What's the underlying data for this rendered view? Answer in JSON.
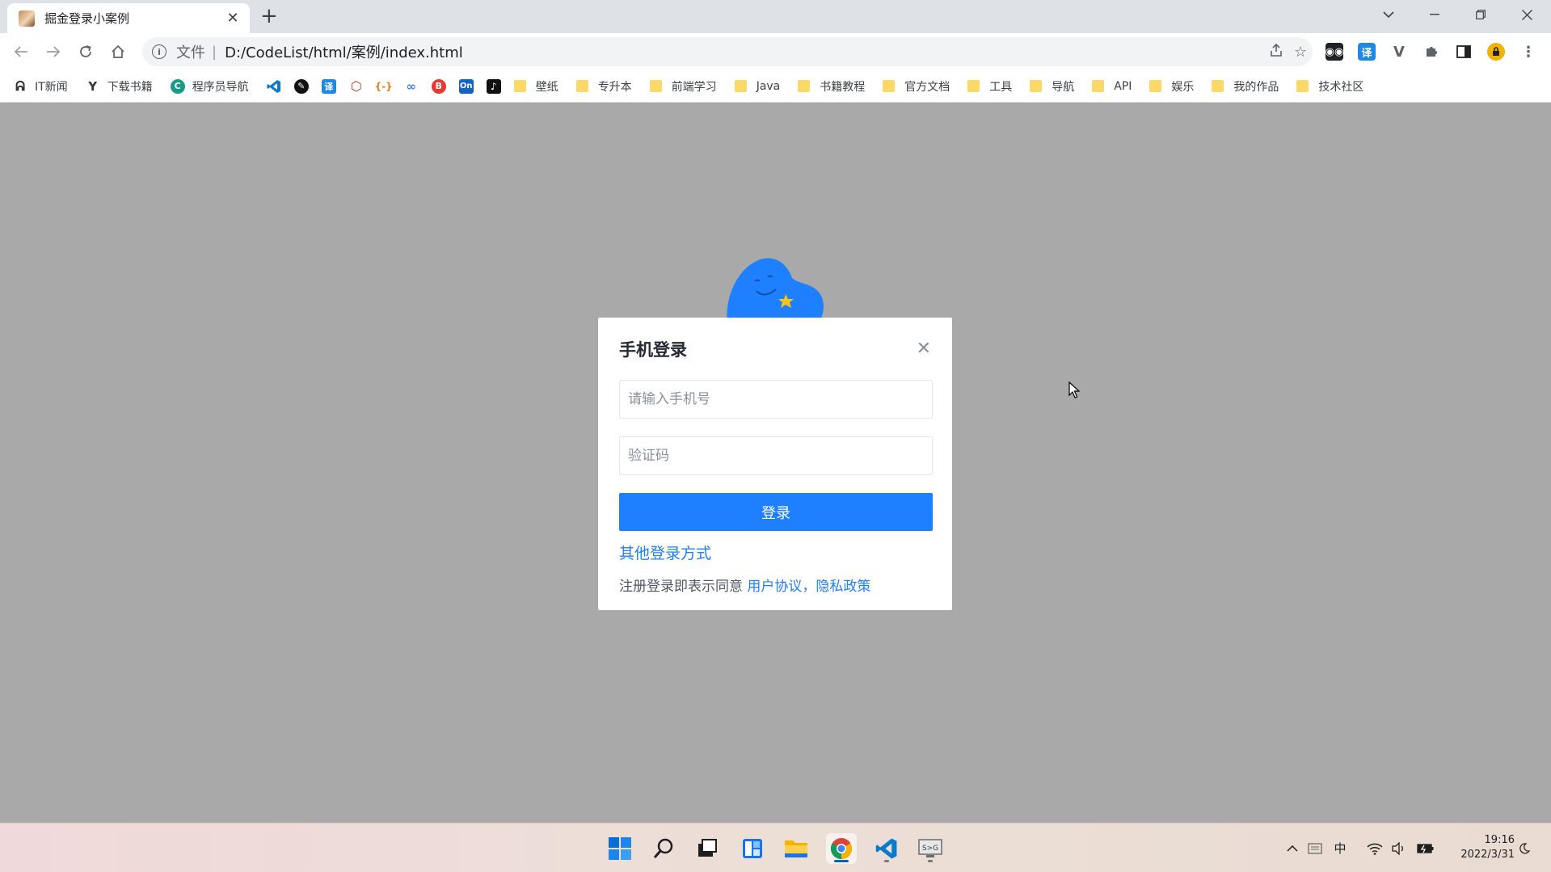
{
  "browser": {
    "tab_title": "掘金登录小案例",
    "address_scheme": "文件",
    "address_url": "D:/CodeList/html/案例/index.html"
  },
  "bookmarks": [
    {
      "type": "site",
      "label": "IT新闻",
      "icon": "it-news-icon"
    },
    {
      "type": "site",
      "label": "下载书籍",
      "icon": "book-download-icon"
    },
    {
      "type": "site",
      "label": "程序员导航",
      "icon": "coder-nav-icon"
    },
    {
      "type": "site",
      "label": "",
      "icon": "vscode-icon"
    },
    {
      "type": "site",
      "label": "",
      "icon": "pen-icon"
    },
    {
      "type": "site",
      "label": "",
      "icon": "translate-icon"
    },
    {
      "type": "site",
      "label": "",
      "icon": "hexagon-icon"
    },
    {
      "type": "site",
      "label": "",
      "icon": "code-bracket-icon"
    },
    {
      "type": "site",
      "label": "",
      "icon": "link-icon"
    },
    {
      "type": "site",
      "label": "",
      "icon": "bilibili-icon"
    },
    {
      "type": "site",
      "label": "",
      "icon": "onenote-icon"
    },
    {
      "type": "site",
      "label": "",
      "icon": "tiktok-icon"
    },
    {
      "type": "folder",
      "label": "壁纸"
    },
    {
      "type": "folder",
      "label": "专升本"
    },
    {
      "type": "folder",
      "label": "前端学习"
    },
    {
      "type": "folder",
      "label": "Java"
    },
    {
      "type": "folder",
      "label": "书籍教程"
    },
    {
      "type": "folder",
      "label": "官方文档"
    },
    {
      "type": "folder",
      "label": "工具"
    },
    {
      "type": "folder",
      "label": "导航"
    },
    {
      "type": "folder",
      "label": "API"
    },
    {
      "type": "folder",
      "label": "娱乐"
    },
    {
      "type": "folder",
      "label": "我的作品"
    },
    {
      "type": "folder",
      "label": "技术社区"
    }
  ],
  "modal": {
    "title": "手机登录",
    "phone_placeholder": "请输入手机号",
    "code_placeholder": "验证码",
    "login_label": "登录",
    "other_login": "其他登录方式",
    "agreement_prefix": "注册登录即表示同意 ",
    "user_agreement": "用户协议",
    "comma": "，",
    "privacy_policy": "隐私政策"
  },
  "taskbar": {
    "time": "19:16",
    "date": "2022/3/31",
    "ime": "中"
  },
  "colors": {
    "accent": "#1e80ff",
    "overlay": "#a8a9a8"
  }
}
